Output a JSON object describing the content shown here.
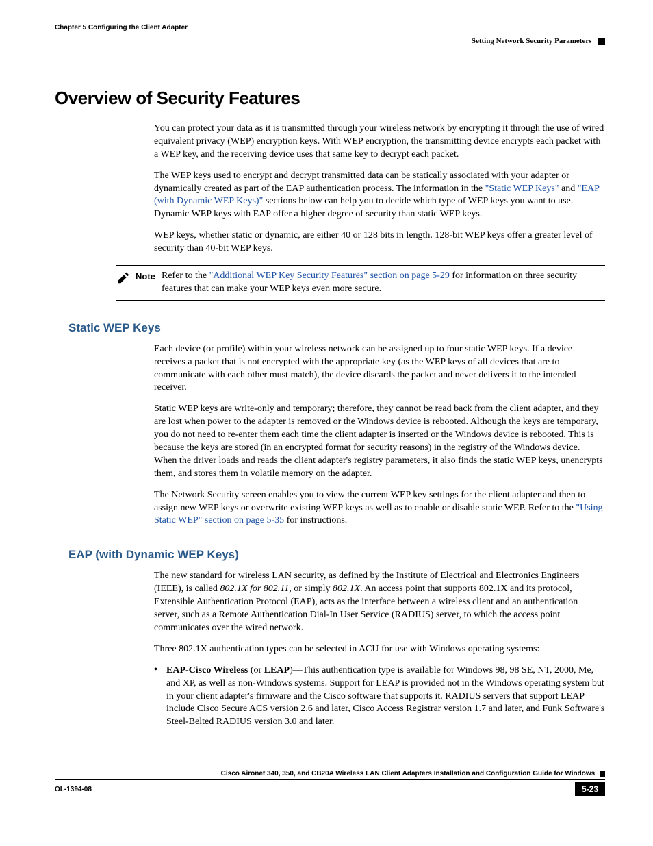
{
  "header": {
    "chapter": "Chapter 5      Configuring the Client Adapter",
    "section": "Setting Network Security Parameters"
  },
  "h1": "Overview of Security Features",
  "intro": {
    "p1": "You can protect your data as it is transmitted through your wireless network by encrypting it through the use of wired equivalent privacy (WEP) encryption keys. With WEP encryption, the transmitting device encrypts each packet with a WEP key, and the receiving device uses that same key to decrypt each packet.",
    "p2a": "The WEP keys used to encrypt and decrypt transmitted data can be statically associated with your adapter or dynamically created as part of the EAP authentication process. The information in the ",
    "p2link1": "\"Static WEP Keys\"",
    "p2b": " and ",
    "p2link2": "\"EAP (with Dynamic WEP Keys)\"",
    "p2c": " sections below can help you to decide which type of WEP keys you want to use. Dynamic WEP keys with EAP offer a higher degree of security than static WEP keys.",
    "p3": "WEP keys, whether static or dynamic, are either 40 or 128 bits in length. 128-bit WEP keys offer a greater level of security than 40-bit WEP keys."
  },
  "note": {
    "label": "Note",
    "pre": "Refer to the ",
    "link": "\"Additional WEP Key Security Features\" section on page 5-29",
    "post": " for information on three security features that can make your WEP keys even more secure."
  },
  "static": {
    "title": "Static WEP Keys",
    "p1": "Each device (or profile) within your wireless network can be assigned up to four static WEP keys. If a device receives a packet that is not encrypted with the appropriate key (as the WEP keys of all devices that are to communicate with each other must match), the device discards the packet and never delivers it to the intended receiver.",
    "p2": "Static WEP keys are write-only and temporary; therefore, they cannot be read back from the client adapter, and they are lost when power to the adapter is removed or the Windows device is rebooted. Although the keys are temporary, you do not need to re-enter them each time the client adapter is inserted or the Windows device is rebooted. This is because the keys are stored (in an encrypted format for security reasons) in the registry of the Windows device. When the driver loads and reads the client adapter's registry parameters, it also finds the static WEP keys, unencrypts them, and stores them in volatile memory on the adapter.",
    "p3a": "The Network Security screen enables you to view the current WEP key settings for the client adapter and then to assign new WEP keys or overwrite existing WEP keys as well as to enable or disable static WEP. Refer to the ",
    "p3link": "\"Using Static WEP\" section on page 5-35",
    "p3b": " for instructions."
  },
  "eap": {
    "title": "EAP (with Dynamic WEP Keys)",
    "p1a": "The new standard for wireless LAN security, as defined by the Institute of Electrical and Electronics Engineers (IEEE), is called ",
    "p1i1": "802.1X for 802.11",
    "p1b": ", or simply ",
    "p1i2": "802.1X",
    "p1c": ". An access point that supports 802.1X and its protocol, Extensible Authentication Protocol (EAP), acts as the interface between a wireless client and an authentication server, such as a Remote Authentication Dial-In User Service (RADIUS) server, to which the access point communicates over the wired network.",
    "p2": "Three 802.1X authentication types can be selected in ACU for use with Windows operating systems:",
    "bullet": {
      "b1": "EAP-Cisco Wireless",
      "b2": " (or ",
      "b3": "LEAP",
      "b4": ")—This authentication type is available for Windows 98, 98 SE, NT, 2000, Me, and XP, as well as non-Windows systems. Support for LEAP is provided not in the Windows operating system but in your client adapter's firmware and the Cisco software that supports it. RADIUS servers that support LEAP include Cisco Secure ACS version 2.6 and later, Cisco Access Registrar version 1.7 and later, and Funk Software's Steel-Belted RADIUS version 3.0 and later."
    }
  },
  "footer": {
    "guide": "Cisco Aironet 340, 350, and CB20A Wireless LAN Client Adapters Installation and Configuration Guide for Windows",
    "doc": "OL-1394-08",
    "page": "5-23"
  }
}
